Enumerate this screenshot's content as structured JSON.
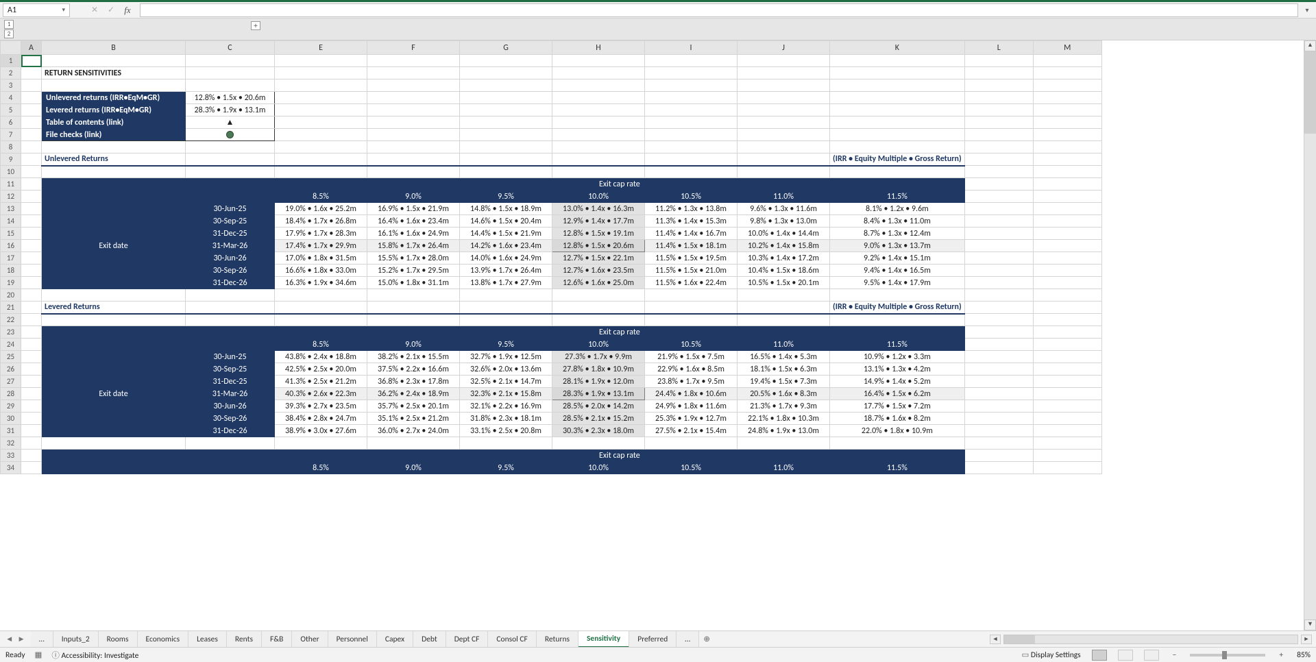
{
  "nameBox": "A1",
  "formula": "",
  "outlineLevels": [
    "1",
    "2"
  ],
  "columns": [
    "A",
    "B",
    "C",
    "E",
    "F",
    "G",
    "H",
    "I",
    "J",
    "K",
    "L",
    "M"
  ],
  "title": "RETURN SENSITIVITIES",
  "summaryBox": {
    "rows": [
      {
        "label": "Unlevered returns (IRR•EqM•GR)",
        "value": "12.8% • 1.5x • 20.6m"
      },
      {
        "label": "Levered returns (IRR•EqM•GR)",
        "value": "28.3% • 1.9x • 13.1m"
      },
      {
        "label": "Table of contents (link)",
        "value": "▲"
      },
      {
        "label": "File checks (link)",
        "value": "●"
      }
    ]
  },
  "sections": [
    {
      "name": "Unlevered Returns",
      "subtitle": "(IRR • Equity Multiple • Gross Return)",
      "colHeader": "Exit cap rate",
      "rowHeader": "Exit date",
      "capRates": [
        "8.5%",
        "9.0%",
        "9.5%",
        "10.0%",
        "10.5%",
        "11.0%",
        "11.5%"
      ],
      "hlCol": 3,
      "hlRow": 3,
      "dates": [
        "30-Jun-25",
        "30-Sep-25",
        "31-Dec-25",
        "31-Mar-26",
        "30-Jun-26",
        "30-Sep-26",
        "31-Dec-26"
      ],
      "rows": [
        [
          "19.0% • 1.6x • 25.2m",
          "16.9% • 1.5x • 21.9m",
          "14.8% • 1.5x • 18.9m",
          "13.0% • 1.4x • 16.3m",
          "11.2% • 1.3x • 13.8m",
          "9.6% • 1.3x • 11.6m",
          "8.1% • 1.2x • 9.6m"
        ],
        [
          "18.4% • 1.7x • 26.8m",
          "16.4% • 1.6x • 23.4m",
          "14.6% • 1.5x • 20.4m",
          "12.9% • 1.4x • 17.7m",
          "11.3% • 1.4x • 15.3m",
          "9.8% • 1.3x • 13.0m",
          "8.4% • 1.3x • 11.0m"
        ],
        [
          "17.9% • 1.7x • 28.3m",
          "16.1% • 1.6x • 24.9m",
          "14.4% • 1.5x • 21.9m",
          "12.8% • 1.5x • 19.1m",
          "11.4% • 1.4x • 16.7m",
          "10.0% • 1.4x • 14.4m",
          "8.7% • 1.3x • 12.4m"
        ],
        [
          "17.4% • 1.7x • 29.9m",
          "15.8% • 1.7x • 26.4m",
          "14.2% • 1.6x • 23.4m",
          "12.8% • 1.5x • 20.6m",
          "11.4% • 1.5x • 18.1m",
          "10.2% • 1.4x • 15.8m",
          "9.0% • 1.3x • 13.7m"
        ],
        [
          "17.0% • 1.8x • 31.5m",
          "15.5% • 1.7x • 28.0m",
          "14.0% • 1.6x • 24.9m",
          "12.7% • 1.5x • 22.1m",
          "11.5% • 1.5x • 19.5m",
          "10.3% • 1.4x • 17.2m",
          "9.2% • 1.4x • 15.1m"
        ],
        [
          "16.6% • 1.8x • 33.0m",
          "15.2% • 1.7x • 29.5m",
          "13.9% • 1.7x • 26.4m",
          "12.7% • 1.6x • 23.5m",
          "11.5% • 1.5x • 21.0m",
          "10.4% • 1.5x • 18.6m",
          "9.4% • 1.4x • 16.5m"
        ],
        [
          "16.3% • 1.9x • 34.6m",
          "15.0% • 1.8x • 31.1m",
          "13.8% • 1.7x • 27.9m",
          "12.6% • 1.6x • 25.0m",
          "11.5% • 1.6x • 22.4m",
          "10.5% • 1.5x • 20.1m",
          "9.5% • 1.4x • 17.9m"
        ]
      ]
    },
    {
      "name": "Levered Returns",
      "subtitle": "(IRR • Equity Multiple • Gross Return)",
      "colHeader": "Exit cap rate",
      "rowHeader": "Exit date",
      "capRates": [
        "8.5%",
        "9.0%",
        "9.5%",
        "10.0%",
        "10.5%",
        "11.0%",
        "11.5%"
      ],
      "hlCol": 3,
      "hlRow": 3,
      "dates": [
        "30-Jun-25",
        "30-Sep-25",
        "31-Dec-25",
        "31-Mar-26",
        "30-Jun-26",
        "30-Sep-26",
        "31-Dec-26"
      ],
      "rows": [
        [
          "43.8% • 2.4x • 18.8m",
          "38.2% • 2.1x • 15.5m",
          "32.7% • 1.9x • 12.5m",
          "27.3% • 1.7x • 9.9m",
          "21.9% • 1.5x • 7.5m",
          "16.5% • 1.4x • 5.3m",
          "10.9% • 1.2x • 3.3m"
        ],
        [
          "42.5% • 2.5x • 20.0m",
          "37.5% • 2.2x • 16.6m",
          "32.6% • 2.0x • 13.6m",
          "27.8% • 1.8x • 10.9m",
          "22.9% • 1.6x • 8.5m",
          "18.1% • 1.5x • 6.3m",
          "13.1% • 1.3x • 4.2m"
        ],
        [
          "41.3% • 2.5x • 21.2m",
          "36.8% • 2.3x • 17.8m",
          "32.5% • 2.1x • 14.7m",
          "28.1% • 1.9x • 12.0m",
          "23.8% • 1.7x • 9.5m",
          "19.4% • 1.5x • 7.3m",
          "14.9% • 1.4x • 5.2m"
        ],
        [
          "40.3% • 2.6x • 22.3m",
          "36.2% • 2.4x • 18.9m",
          "32.3% • 2.1x • 15.8m",
          "28.3% • 1.9x • 13.1m",
          "24.4% • 1.8x • 10.6m",
          "20.5% • 1.6x • 8.3m",
          "16.4% • 1.5x • 6.2m"
        ],
        [
          "39.3% • 2.7x • 23.5m",
          "35.7% • 2.5x • 20.1m",
          "32.1% • 2.2x • 16.9m",
          "28.5% • 2.0x • 14.2m",
          "24.9% • 1.8x • 11.6m",
          "21.3% • 1.7x • 9.3m",
          "17.7% • 1.5x • 7.2m"
        ],
        [
          "38.4% • 2.8x • 24.7m",
          "35.1% • 2.5x • 21.2m",
          "31.8% • 2.3x • 18.1m",
          "28.5% • 2.1x • 15.2m",
          "25.3% • 1.9x • 12.7m",
          "22.1% • 1.8x • 10.3m",
          "18.7% • 1.6x • 8.2m"
        ],
        [
          "38.9% • 3.0x • 27.6m",
          "36.0% • 2.7x • 24.0m",
          "33.1% • 2.5x • 20.8m",
          "30.3% • 2.3x • 18.0m",
          "27.5% • 2.1x • 15.4m",
          "24.8% • 1.9x • 13.0m",
          "22.0% • 1.8x • 10.9m"
        ]
      ]
    },
    {
      "name": "",
      "subtitle": "",
      "colHeader": "Exit cap rate",
      "rowHeader": "",
      "capRates": [
        "8.5%",
        "9.0%",
        "9.5%",
        "10.0%",
        "10.5%",
        "11.0%",
        "11.5%"
      ],
      "hlCol": 3,
      "hlRow": -1,
      "dates": [],
      "rows": []
    }
  ],
  "tabs": [
    "…",
    "Inputs_2",
    "Rooms",
    "Economics",
    "Leases",
    "Rents",
    "F&B",
    "Other",
    "Personnel",
    "Capex",
    "Debt",
    "Dept CF",
    "Consol CF",
    "Returns",
    "Sensitivity",
    "Preferred",
    "…"
  ],
  "activeTab": "Sensitivity",
  "status": {
    "mode": "Ready",
    "accessibility": "Accessibility: Investigate",
    "display": "Display Settings",
    "zoom": "85%"
  },
  "rowNumbers": [
    1,
    2,
    3,
    4,
    5,
    6,
    7,
    8,
    9,
    10,
    11,
    12,
    13,
    14,
    15,
    16,
    17,
    18,
    19,
    20,
    21,
    22,
    23,
    24,
    25,
    26,
    27,
    28,
    29,
    30,
    31,
    32,
    33,
    34
  ]
}
